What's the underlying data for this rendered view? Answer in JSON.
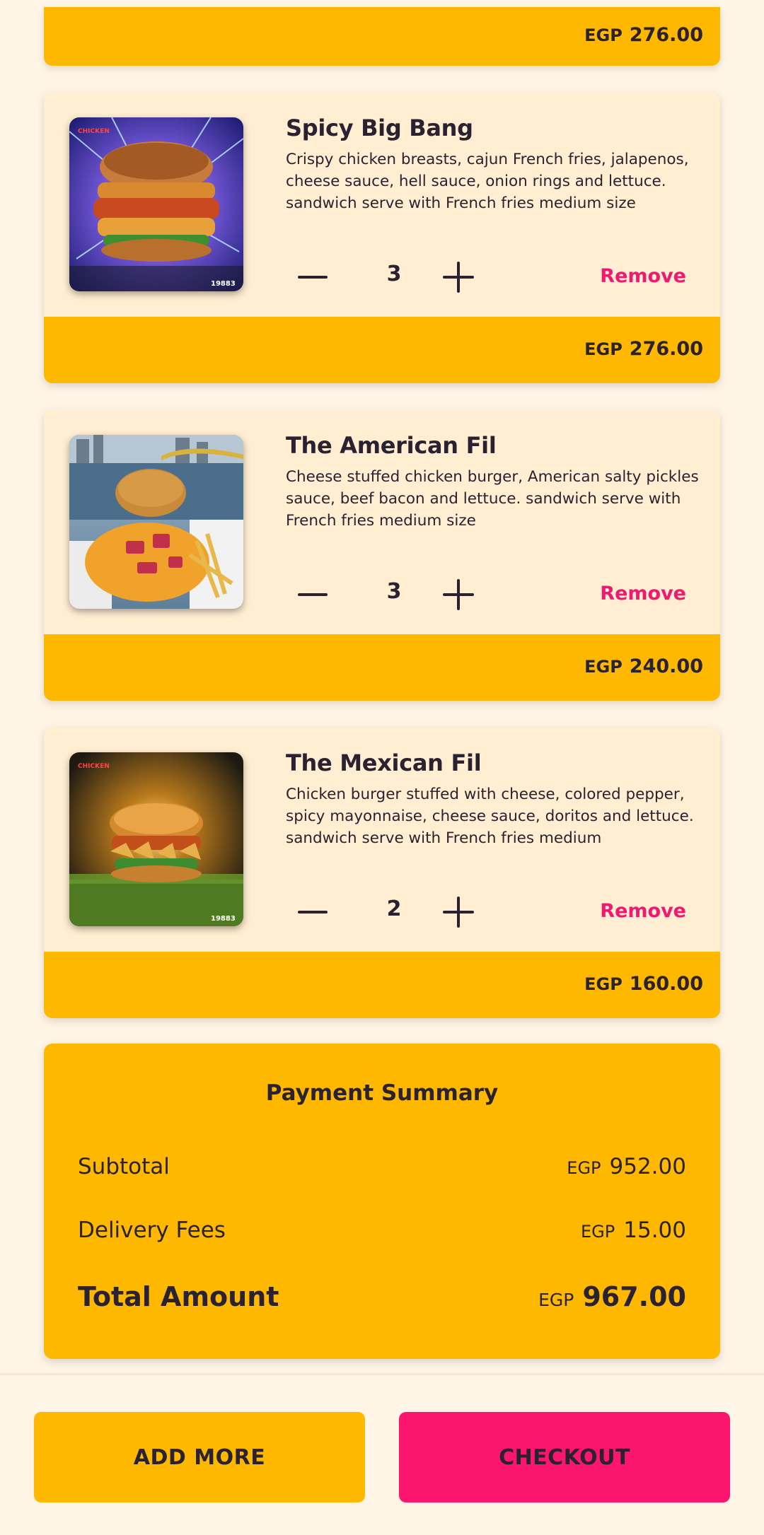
{
  "top_partial": {
    "currency": "EGP",
    "price": "276.00"
  },
  "items": [
    {
      "title": "Spicy Big Bang",
      "description": "Crispy chicken breasts, cajun French fries, jalapenos, cheese sauce, hell sauce, onion rings and lettuce. sandwich serve with French fries medium size",
      "quantity": "3",
      "remove_label": "Remove",
      "currency": "EGP",
      "price": "276.00"
    },
    {
      "title": "The American Fil",
      "description": "Cheese stuffed chicken burger, American salty pickles sauce, beef bacon and lettuce. sandwich serve with French fries medium size",
      "quantity": "3",
      "remove_label": "Remove",
      "currency": "EGP",
      "price": "240.00"
    },
    {
      "title": "The Mexican Fil",
      "description": "Chicken burger stuffed with cheese, colored pepper, spicy mayonnaise, cheese sauce, doritos and lettuce. sandwich serve with French fries medium",
      "quantity": "2",
      "remove_label": "Remove",
      "currency": "EGP",
      "price": "160.00"
    }
  ],
  "summary": {
    "title": "Payment Summary",
    "subtotal_label": "Subtotal",
    "subtotal_currency": "EGP",
    "subtotal_value": "952.00",
    "delivery_label": "Delivery Fees",
    "delivery_currency": "EGP",
    "delivery_value": "15.00",
    "total_label": "Total Amount",
    "total_currency": "EGP",
    "total_value": "967.00"
  },
  "actions": {
    "add_more_label": "ADD MORE",
    "checkout_label": "CHECKOUT"
  },
  "colors": {
    "background": "#fff5e6",
    "card": "#ffeed2",
    "accent_yellow": "#ffb800",
    "accent_pink": "#fc156d",
    "remove_text": "#f0186f",
    "text": "#2a2230"
  },
  "icons": {
    "minus": "minus-icon",
    "plus": "plus-icon"
  }
}
